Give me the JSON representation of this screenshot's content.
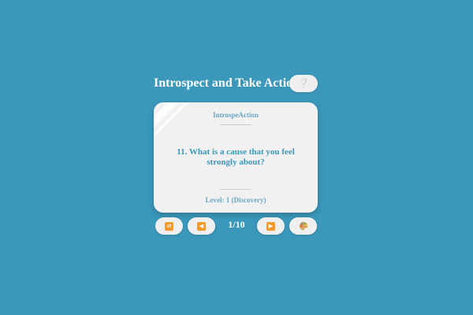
{
  "header": {
    "title": "Introspect and Take Action",
    "help_label": "❔"
  },
  "card": {
    "brand": "IntrospeAction",
    "question": "11. What is a cause that you feel strongly about?",
    "level": "Level: 1 (Discovery)"
  },
  "controls": {
    "shuffle_glyph": "⇄",
    "prev_glyph": "◀",
    "counter": "1/10",
    "next_glyph": "▶",
    "theme_icon": "palette-icon"
  },
  "colors": {
    "background": "#3b98bb",
    "card": "#f1f1f1",
    "accent_text": "#3b98bb",
    "icon_orange": "#f39a2b"
  }
}
